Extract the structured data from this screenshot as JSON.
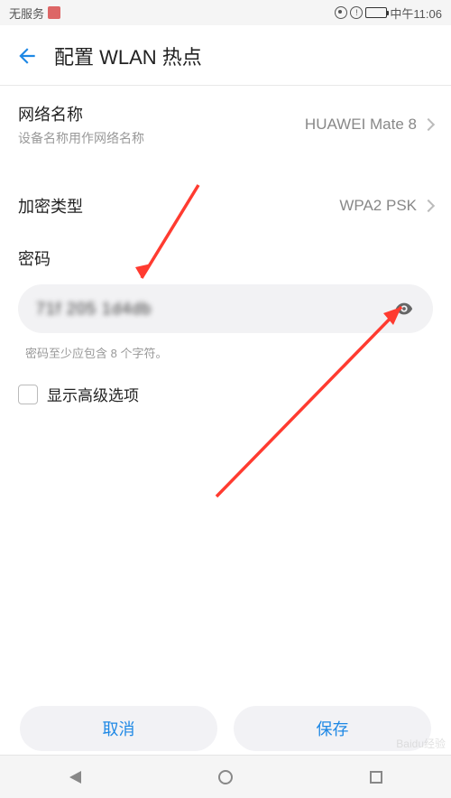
{
  "status": {
    "no_service": "无服务",
    "time": "中午11:06"
  },
  "header": {
    "title": "配置 WLAN 热点"
  },
  "network_name": {
    "label": "网络名称",
    "subtitle": "设备名称用作网络名称",
    "value": "HUAWEI Mate 8"
  },
  "encryption": {
    "label": "加密类型",
    "value": "WPA2 PSK"
  },
  "password": {
    "label": "密码",
    "value": "71f  205 1d4db",
    "hint": "密码至少应包含 8 个字符。"
  },
  "advanced": {
    "label": "显示高级选项",
    "checked": false
  },
  "buttons": {
    "cancel": "取消",
    "save": "保存"
  },
  "watermark": "Baidu经验"
}
